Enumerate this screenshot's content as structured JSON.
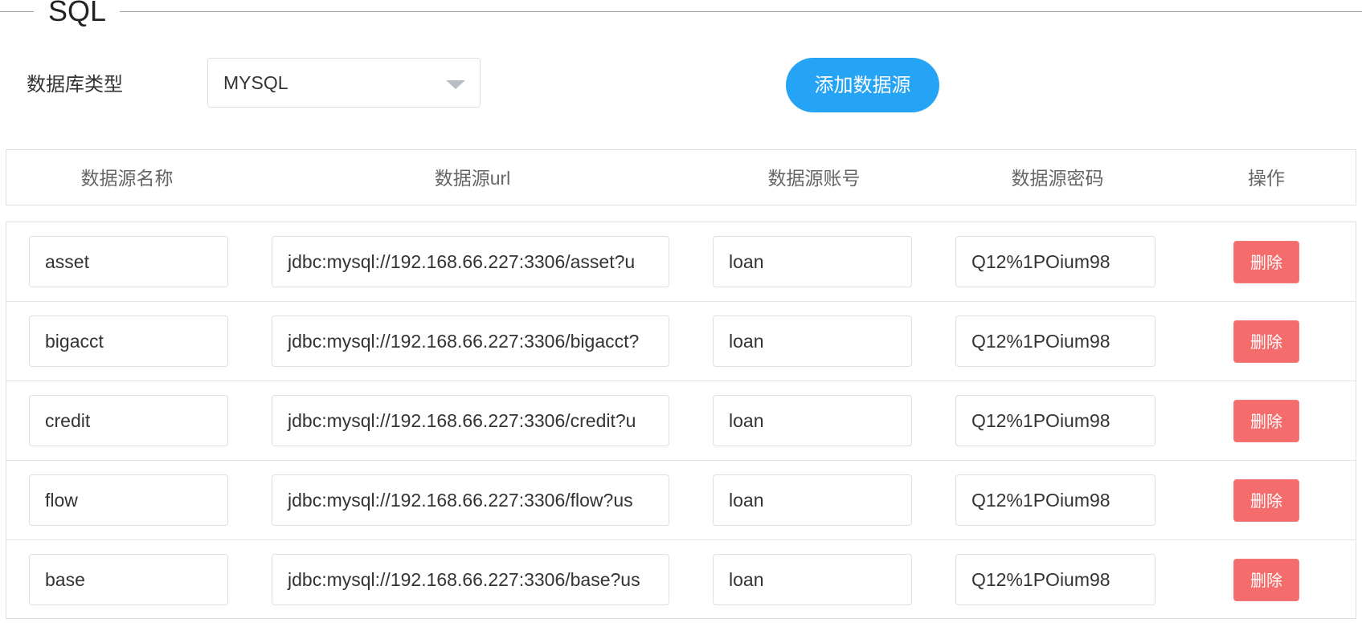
{
  "fieldset": {
    "legend": "SQL"
  },
  "form": {
    "db_type_label": "数据库类型",
    "db_type_value": "MYSQL",
    "add_button_label": "添加数据源"
  },
  "table": {
    "headers": [
      "数据源名称",
      "数据源url",
      "数据源账号",
      "数据源密码",
      "操作"
    ],
    "rows": [
      {
        "name": "asset",
        "url": "jdbc:mysql://192.168.66.227:3306/asset?u",
        "account": "loan",
        "password": "Q12%1POium98",
        "action": "删除"
      },
      {
        "name": "bigacct",
        "url": "jdbc:mysql://192.168.66.227:3306/bigacct?",
        "account": "loan",
        "password": "Q12%1POium98",
        "action": "删除"
      },
      {
        "name": "credit",
        "url": "jdbc:mysql://192.168.66.227:3306/credit?u",
        "account": "loan",
        "password": "Q12%1POium98",
        "action": "删除"
      },
      {
        "name": "flow",
        "url": "jdbc:mysql://192.168.66.227:3306/flow?us",
        "account": "loan",
        "password": "Q12%1POium98",
        "action": "删除"
      },
      {
        "name": "base",
        "url": "jdbc:mysql://192.168.66.227:3306/base?us",
        "account": "loan",
        "password": "Q12%1POium98",
        "action": "删除"
      }
    ]
  },
  "colors": {
    "primary": "#25a3f5",
    "danger": "#f56c6c",
    "border": "#dcdfe6"
  }
}
